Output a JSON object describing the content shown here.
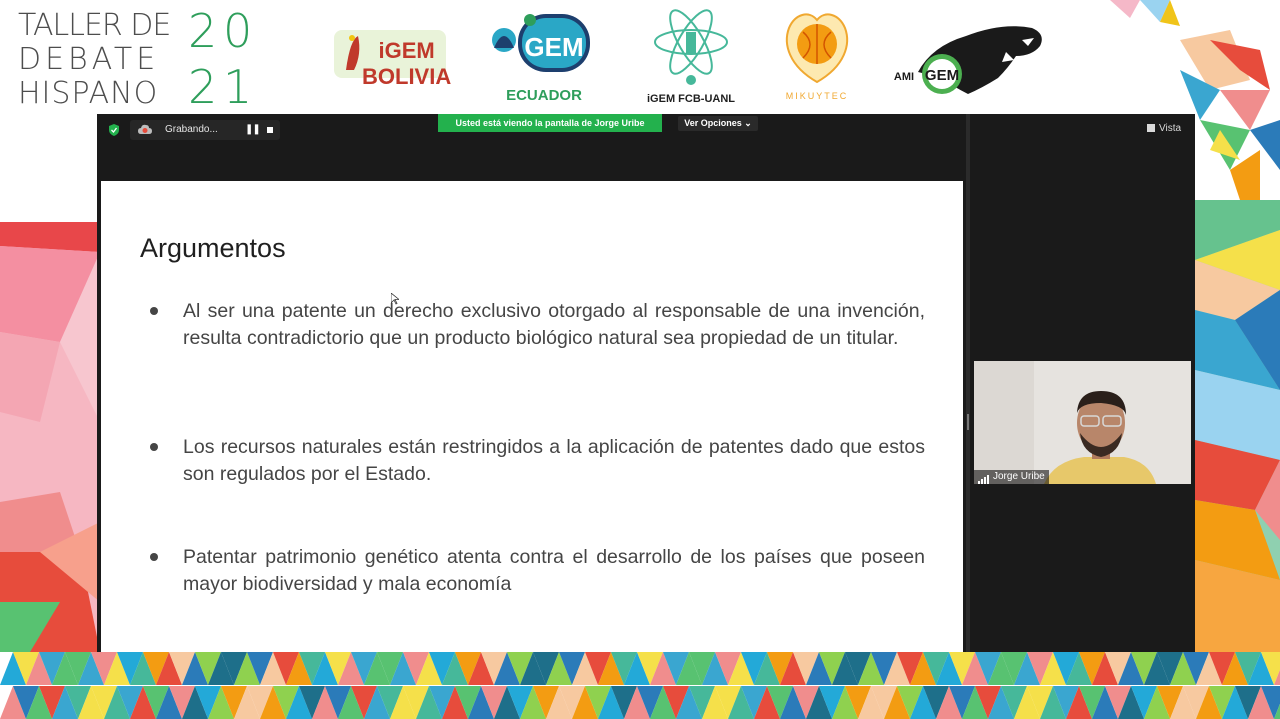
{
  "event": {
    "title_lines": [
      "TALLER DE",
      "DEBATE",
      "HISPANO"
    ],
    "year_digits": [
      "2",
      "0",
      "2",
      "1"
    ]
  },
  "logos": [
    {
      "name": "igem-bolivia",
      "caption": "iGEM BOLIVIA"
    },
    {
      "name": "igem-ecuador",
      "caption": "ECUADOR"
    },
    {
      "name": "igem-fcb-uanl",
      "caption": "iGEM FCB-UANL"
    },
    {
      "name": "mikuytec",
      "caption": "MIKUYTEC"
    },
    {
      "name": "igem-panther",
      "caption": "iGEM"
    }
  ],
  "zoom": {
    "recording_label": "Grabando...",
    "pause_glyph": "❚❚",
    "share_banner": "Usted está viendo la pantalla de Jorge Uribe",
    "view_options": "Ver Opciones",
    "view_options_chevron": "⌄",
    "view_label": "Vista",
    "participant_name": "Jorge Uribe"
  },
  "slide": {
    "title": "Argumentos",
    "bullets": [
      "Al ser una patente un derecho exclusivo otorgado al responsable de una invención, resulta contradictorio que un producto biológico natural sea propiedad de un titular.",
      "Los recursos naturales están restringidos a la aplicación de patentes dado que estos son regulados por el Estado.",
      "Patentar patrimonio genético atenta contra el desarrollo de los países que poseen mayor biodiversidad y mala economía"
    ]
  },
  "colors": {
    "share_banner": "#23b14d",
    "year_green": "#2e9e5b",
    "zoom_dark": "#1a1a1a"
  }
}
